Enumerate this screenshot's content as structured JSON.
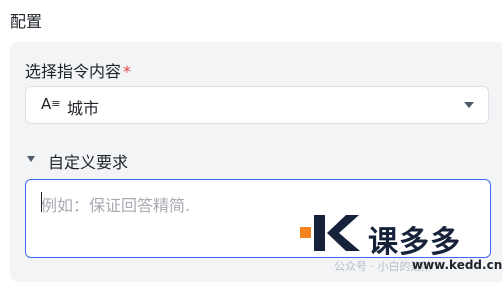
{
  "section": {
    "title": "配置"
  },
  "instruction_field": {
    "label": "选择指令内容",
    "required_mark": "*",
    "selected_value": "城市",
    "type_icon": "A≡"
  },
  "custom_requirements": {
    "label": "自定义要求",
    "expanded": true,
    "placeholder": "例如：保证回答精简."
  },
  "watermark": {
    "brand": "课多多",
    "sub": "公众号 · 小白的进阶",
    "url": "www.kedd.cn"
  },
  "colors": {
    "accent": "#3b6cf6",
    "required": "#e5484d",
    "logo_orange": "#f5821f",
    "logo_dark": "#16213a"
  }
}
